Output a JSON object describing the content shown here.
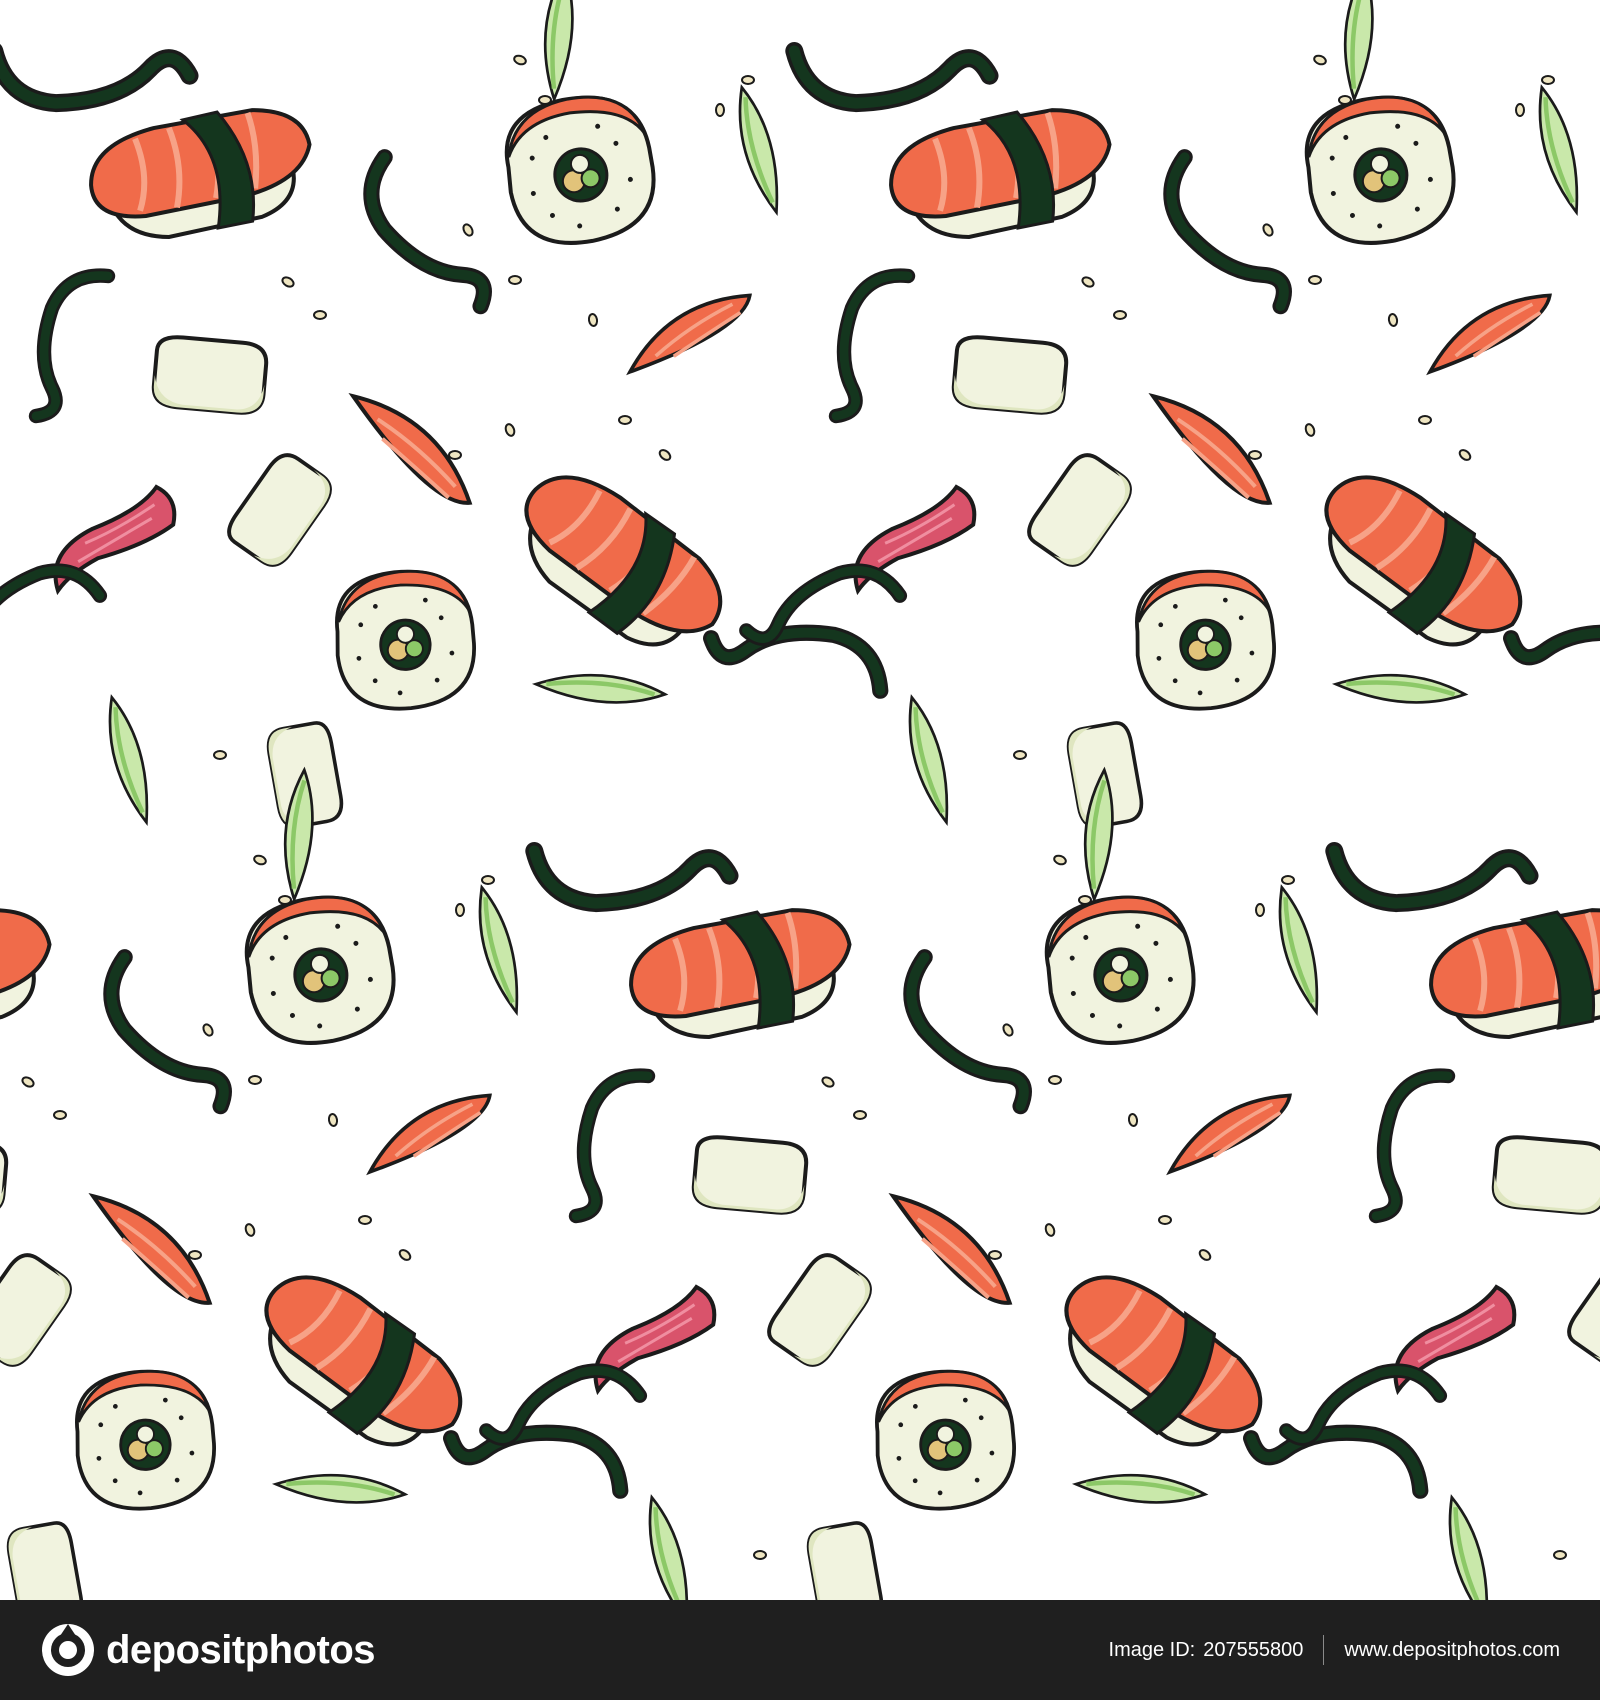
{
  "footer": {
    "logo_text": "depositphotos",
    "image_id_label": "Image ID:",
    "image_id": "207555800",
    "site_url": "www.depositphotos.com"
  },
  "pattern": {
    "motifs": [
      "nigiri-salmon",
      "maki-roll",
      "sashimi-slice",
      "tuna-slice",
      "rice-block",
      "seaweed-strip",
      "green-onion-leaf",
      "sesame-seed"
    ],
    "colors": {
      "salmon": "#f06b4a",
      "salmon_light": "#f7a287",
      "tuna": "#d9536b",
      "rice": "#f1f3df",
      "rice_shade": "#dfe6c0",
      "nori": "#14361e",
      "leaf": "#8cc867",
      "leaf_light": "#c9e8aa",
      "outline": "#1b1b1b",
      "footer_bg": "#1f1f1f"
    }
  }
}
